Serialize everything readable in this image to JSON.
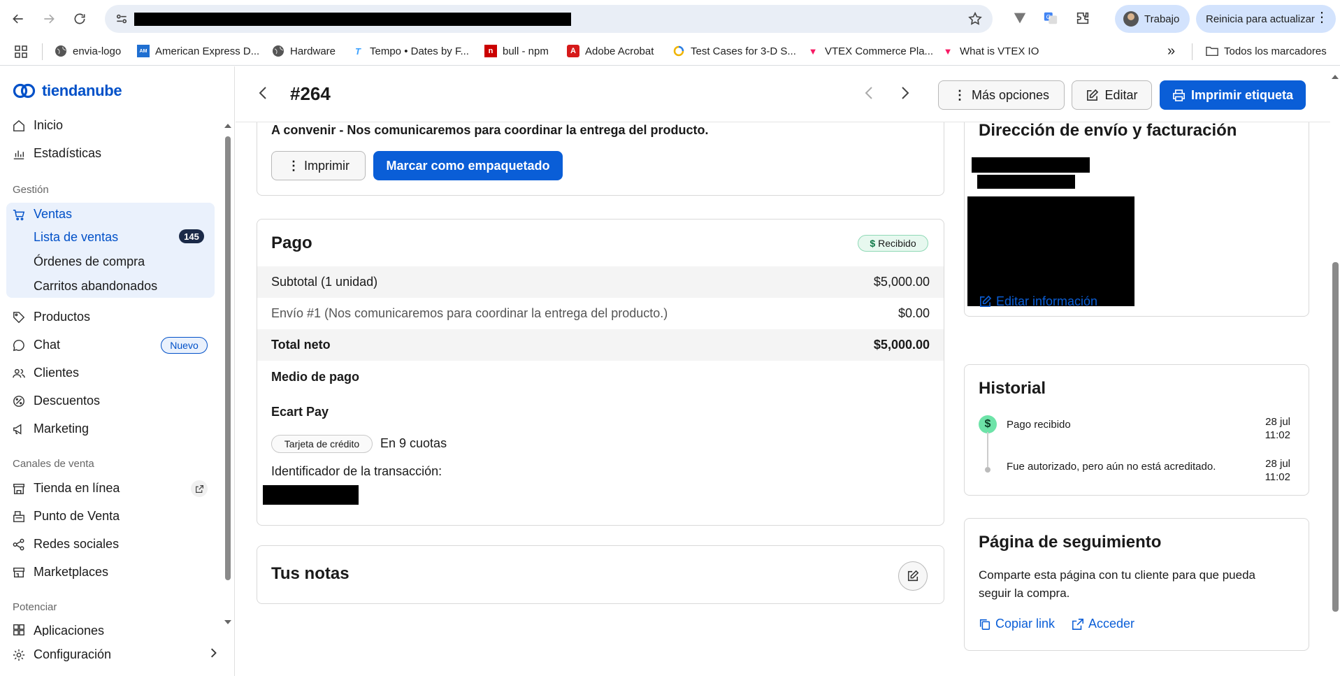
{
  "browser": {
    "profile_label": "Trabajo",
    "update_label": "Reinicia para actualizar",
    "bookmarks": [
      {
        "label": "envia-logo",
        "icon": "globe-icon"
      },
      {
        "label": "American Express D...",
        "icon": "amex-icon"
      },
      {
        "label": "Hardware",
        "icon": "globe-icon"
      },
      {
        "label": "Tempo • Dates by F...",
        "icon": "tempo-icon"
      },
      {
        "label": "bull - npm",
        "icon": "npm-icon"
      },
      {
        "label": "Adobe Acrobat",
        "icon": "acrobat-icon"
      },
      {
        "label": "Test Cases for 3-D S...",
        "icon": "testcases-icon"
      },
      {
        "label": "VTEX Commerce Pla...",
        "icon": "vtex-icon"
      },
      {
        "label": "What is VTEX IO",
        "icon": "vtex-icon"
      }
    ],
    "more_label": "»",
    "all_bookmarks_label": "Todos los marcadores"
  },
  "sidebar": {
    "brand": "tiendanube",
    "items_top": [
      "Inicio",
      "Estadísticas"
    ],
    "section_gestion": "Gestión",
    "ventas": "Ventas",
    "ventas_sub": [
      "Lista de ventas",
      "Órdenes de compra",
      "Carritos abandonados"
    ],
    "ventas_count": "145",
    "items_gestion": [
      "Productos",
      "Chat",
      "Clientes",
      "Descuentos",
      "Marketing"
    ],
    "chat_badge": "Nuevo",
    "section_canales": "Canales de venta",
    "items_canales": [
      "Tienda en línea",
      "Punto de Venta",
      "Redes sociales",
      "Marketplaces"
    ],
    "section_potenciar": "Potenciar",
    "item_aplicaciones": "Aplicaciones",
    "item_config": "Configuración"
  },
  "header": {
    "order_number": "#264",
    "more_options": "Más opciones",
    "edit": "Editar",
    "print_label": "Imprimir etiqueta"
  },
  "shipping_card": {
    "text": "A convenir - Nos comunicaremos para coordinar la entrega del producto.",
    "print_btn": "Imprimir",
    "mark_packed_btn": "Marcar como empaquetado"
  },
  "payment": {
    "title": "Pago",
    "status": "Recibido",
    "rows": [
      {
        "label": "Subtotal (1 unidad)",
        "value": "$5,000.00"
      },
      {
        "label": "Envío #1 (Nos comunicaremos para coordinar la entrega del producto.)",
        "value": "$0.00"
      },
      {
        "label": "Total neto",
        "value": "$5,000.00"
      }
    ],
    "method_heading": "Medio de pago",
    "method_name": "Ecart Pay",
    "card_type": "Tarjeta de crédito",
    "installments": "En 9 cuotas",
    "transaction_label": "Identificador de la transacción:"
  },
  "notes": {
    "title": "Tus notas"
  },
  "address": {
    "title": "Dirección de envío y facturación",
    "edit_link": "Editar información"
  },
  "history": {
    "title": "Historial",
    "events": [
      {
        "text": "Pago recibido",
        "date": "28 jul",
        "time": "11:02"
      },
      {
        "text": "Fue autorizado, pero aún no está acreditado.",
        "date": "28 jul",
        "time": "11:02"
      }
    ]
  },
  "tracking": {
    "title": "Página de seguimiento",
    "description": "Comparte esta página con tu cliente para que pueda seguir la compra.",
    "copy_link": "Copiar link",
    "access": "Acceder"
  },
  "colors": {
    "accent": "#0a5ed7",
    "brand": "#0050c8",
    "success": "#6de3a8"
  }
}
